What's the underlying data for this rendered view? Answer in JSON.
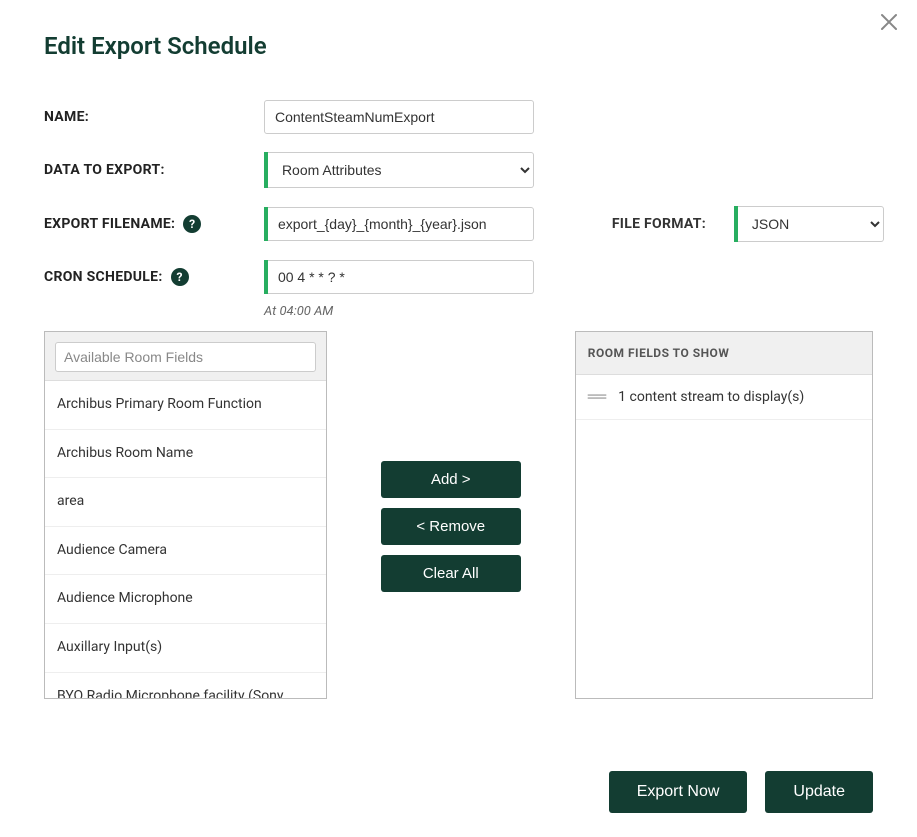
{
  "title": "Edit Export Schedule",
  "form": {
    "name_label": "NAME:",
    "name_value": "ContentSteamNumExport",
    "data_to_export_label": "DATA TO EXPORT:",
    "data_to_export_value": "Room Attributes",
    "export_filename_label": "EXPORT FILENAME:",
    "export_filename_value": "export_{day}_{month}_{year}.json",
    "file_format_label": "FILE FORMAT:",
    "file_format_value": "JSON",
    "cron_schedule_label": "CRON SCHEDULE:",
    "cron_schedule_value": "00 4 * * ? *",
    "cron_caption": "At 04:00 AM"
  },
  "available": {
    "search_placeholder": "Available Room Fields",
    "items": [
      "Archibus Primary Room Function",
      "Archibus Room Name",
      "area",
      "Audience Camera",
      "Audience Microphone",
      "Auxillary Input(s)",
      "BYO Radio Microphone facility (Sony Microphones)"
    ]
  },
  "mid_buttons": {
    "add": "Add >",
    "remove": "< Remove",
    "clear": "Clear All"
  },
  "selected": {
    "header": "ROOM FIELDS TO SHOW",
    "items": [
      "1 content stream to display(s)"
    ]
  },
  "footer": {
    "export_now": "Export Now",
    "update": "Update"
  }
}
